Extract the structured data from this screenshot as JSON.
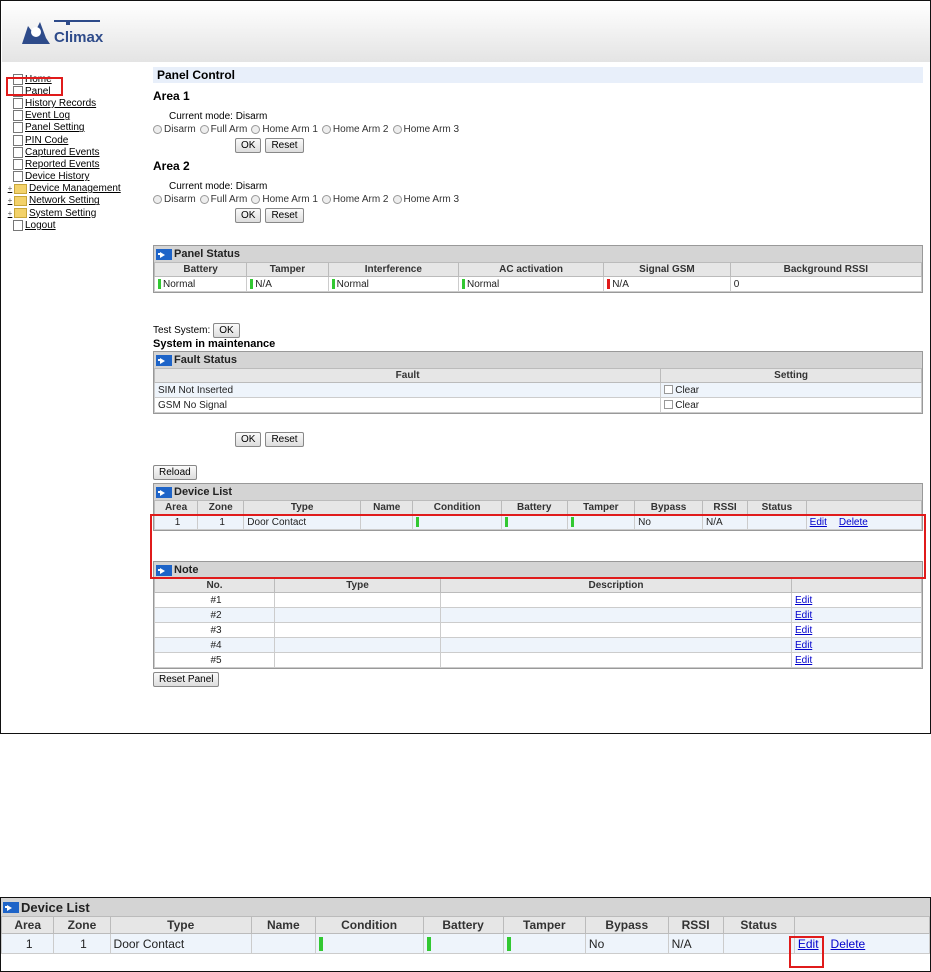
{
  "brand": {
    "name": "Climax"
  },
  "sidebar": {
    "items": [
      {
        "label": "Home",
        "folder": false,
        "tog": ""
      },
      {
        "label": "Panel",
        "folder": false,
        "tog": ""
      },
      {
        "label": "History Records",
        "folder": false,
        "tog": ""
      },
      {
        "label": "Event Log",
        "folder": false,
        "tog": ""
      },
      {
        "label": "Panel Setting",
        "folder": false,
        "tog": ""
      },
      {
        "label": "PIN Code",
        "folder": false,
        "tog": ""
      },
      {
        "label": "Captured Events",
        "folder": false,
        "tog": ""
      },
      {
        "label": "Reported Events",
        "folder": false,
        "tog": ""
      },
      {
        "label": "Device History",
        "folder": false,
        "tog": ""
      },
      {
        "label": "Device Management",
        "folder": true,
        "tog": "+"
      },
      {
        "label": "Network Setting",
        "folder": true,
        "tog": "+"
      },
      {
        "label": "System Setting",
        "folder": true,
        "tog": "+"
      },
      {
        "label": "Logout",
        "folder": false,
        "tog": ""
      }
    ]
  },
  "panel_control": {
    "title": "Panel Control",
    "areas": [
      {
        "title": "Area 1",
        "mode_label": "Current mode:",
        "mode_value": "Disarm"
      },
      {
        "title": "Area 2",
        "mode_label": "Current mode:",
        "mode_value": "Disarm"
      }
    ],
    "radio_options": [
      "Disarm",
      "Full Arm",
      "Home Arm 1",
      "Home Arm 2",
      "Home Arm 3"
    ],
    "ok_label": "OK",
    "reset_label": "Reset"
  },
  "panel_status": {
    "title": "Panel Status",
    "headers": [
      "Battery",
      "Tamper",
      "Interference",
      "AC activation",
      "Signal GSM",
      "Background RSSI"
    ],
    "values": [
      "Normal",
      "N/A",
      "Normal",
      "Normal",
      "N/A",
      "0"
    ]
  },
  "test_system": {
    "label": "Test System:",
    "button": "OK",
    "maintenance": "System in maintenance"
  },
  "fault_status": {
    "title": "Fault Status",
    "headers": [
      "Fault",
      "Setting"
    ],
    "rows": [
      {
        "fault": "SIM Not Inserted",
        "setting": "Clear"
      },
      {
        "fault": "GSM No Signal",
        "setting": "Clear"
      }
    ],
    "ok_label": "OK",
    "reset_label": "Reset"
  },
  "reload_label": "Reload",
  "device_list": {
    "title": "Device List",
    "headers": [
      "Area",
      "Zone",
      "Type",
      "Name",
      "Condition",
      "Battery",
      "Tamper",
      "Bypass",
      "RSSI",
      "Status",
      ""
    ],
    "row": {
      "area": "1",
      "zone": "1",
      "type": "Door Contact",
      "name": "",
      "bypass": "No",
      "rssi": "N/A",
      "status": "",
      "edit": "Edit",
      "delete": "Delete"
    }
  },
  "note": {
    "title": "Note",
    "headers": [
      "No.",
      "Type",
      "Description",
      ""
    ],
    "rows": [
      "#1",
      "#2",
      "#3",
      "#4",
      "#5"
    ],
    "edit": "Edit"
  },
  "reset_panel_label": "Reset Panel",
  "colors": {
    "ok": "#32c832",
    "error": "#e01b1b",
    "highlight": "#e01b1b"
  }
}
